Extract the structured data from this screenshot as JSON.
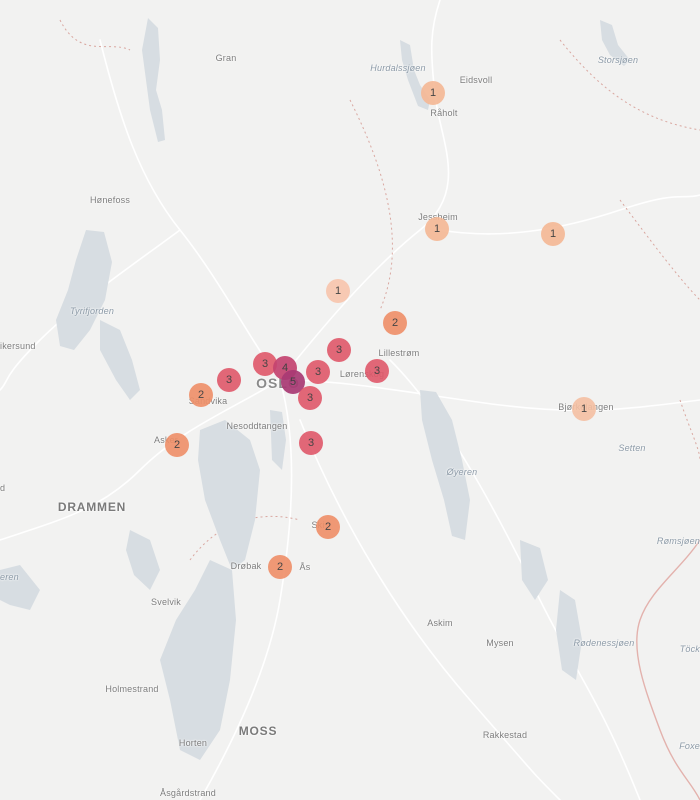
{
  "map": {
    "places": [
      {
        "id": "gran",
        "text": "Gran",
        "cls": "place"
      },
      {
        "id": "hurdalssjoen",
        "text": "Hurdalssjøen",
        "cls": "place water"
      },
      {
        "id": "eidsvoll",
        "text": "Eidsvoll",
        "cls": "place"
      },
      {
        "id": "raholt",
        "text": "Råholt",
        "cls": "place"
      },
      {
        "id": "storsjoen",
        "text": "Storsjøen",
        "cls": "place water"
      },
      {
        "id": "honefoss",
        "text": "Hønefoss",
        "cls": "place"
      },
      {
        "id": "jessheim",
        "text": "Jessheim",
        "cls": "place"
      },
      {
        "id": "tyrifjorden",
        "text": "Tyrifjorden",
        "cls": "place water"
      },
      {
        "id": "krokkleiva",
        "text": "ikersund",
        "cls": "place edge-l"
      },
      {
        "id": "lillestrom",
        "text": "Lillestrøm",
        "cls": "place"
      },
      {
        "id": "lorenskog",
        "text": "Lørenskog",
        "cls": "place"
      },
      {
        "id": "oslo",
        "text": "OSLO",
        "cls": "place major"
      },
      {
        "id": "sandvika",
        "text": "Sandvika",
        "cls": "place"
      },
      {
        "id": "asker",
        "text": "Asker",
        "cls": "place"
      },
      {
        "id": "nesoddtangen",
        "text": "Nesoddtangen",
        "cls": "place"
      },
      {
        "id": "bjorkelangen",
        "text": "Bjørkelangen",
        "cls": "place"
      },
      {
        "id": "setten",
        "text": "Setten",
        "cls": "place water"
      },
      {
        "id": "oyeren",
        "text": "Øyeren",
        "cls": "place water"
      },
      {
        "id": "drammen",
        "text": "DRAMMEN",
        "cls": "place city"
      },
      {
        "id": "ski",
        "text": "Ski",
        "cls": "place"
      },
      {
        "id": "drobak",
        "text": "Drøbak",
        "cls": "place"
      },
      {
        "id": "as",
        "text": "Ås",
        "cls": "place"
      },
      {
        "id": "romsjoen",
        "text": "Rømsjøen",
        "cls": "place water edge-r"
      },
      {
        "id": "svelvik",
        "text": "Svelvik",
        "cls": "place"
      },
      {
        "id": "askim",
        "text": "Askim",
        "cls": "place"
      },
      {
        "id": "mysen",
        "text": "Mysen",
        "cls": "place"
      },
      {
        "id": "rodenessjoen",
        "text": "Rødenessjøen",
        "cls": "place water"
      },
      {
        "id": "tocksfors",
        "text": "Töck",
        "cls": "place water edge-r"
      },
      {
        "id": "holmestrand",
        "text": "Holmestrand",
        "cls": "place"
      },
      {
        "id": "moss",
        "text": "MOSS",
        "cls": "place city"
      },
      {
        "id": "rakkestad",
        "text": "Rakkestad",
        "cls": "place"
      },
      {
        "id": "horten",
        "text": "Horten",
        "cls": "place"
      },
      {
        "id": "foxen",
        "text": "Foxe",
        "cls": "place water edge-r"
      },
      {
        "id": "asgardstrand",
        "text": "Åsgårdstrand",
        "cls": "place"
      },
      {
        "id": "leftd",
        "text": "d",
        "cls": "place edge-l"
      },
      {
        "id": "lefteren",
        "text": "eren",
        "cls": "place water edge-l"
      }
    ],
    "markers": [
      {
        "id": "raholt",
        "count": 1,
        "color": "#f5b895"
      },
      {
        "id": "jessheim",
        "count": 1,
        "color": "#f5b895"
      },
      {
        "id": "nannestad-east",
        "count": 1,
        "color": "#f5b895"
      },
      {
        "id": "skedsmo-north",
        "count": 1,
        "color": "#f8c5ad"
      },
      {
        "id": "skedsmo",
        "count": 2,
        "color": "#ef8f68"
      },
      {
        "id": "bjorkelangen",
        "count": 1,
        "color": "#f5c0a3"
      },
      {
        "id": "groruddalen",
        "count": 3,
        "color": "#e0586a"
      },
      {
        "id": "lorenskog",
        "count": 3,
        "color": "#e0586a"
      },
      {
        "id": "oslo-east",
        "count": 3,
        "color": "#e0586a"
      },
      {
        "id": "oslo-west",
        "count": 3,
        "color": "#e0586a"
      },
      {
        "id": "oslo-center",
        "count": 4,
        "color": "#c44470"
      },
      {
        "id": "oslo-core",
        "count": 5,
        "color": "#a93a74"
      },
      {
        "id": "bekkestua",
        "count": 3,
        "color": "#e0586a"
      },
      {
        "id": "sandvika",
        "count": 2,
        "color": "#ef8f68"
      },
      {
        "id": "oslo-south",
        "count": 3,
        "color": "#e0586a"
      },
      {
        "id": "asker",
        "count": 2,
        "color": "#ef8f68"
      },
      {
        "id": "kolbotn",
        "count": 3,
        "color": "#e0586a"
      },
      {
        "id": "ski",
        "count": 2,
        "color": "#ef8f68"
      },
      {
        "id": "as",
        "count": 2,
        "color": "#ef8f68"
      }
    ]
  }
}
